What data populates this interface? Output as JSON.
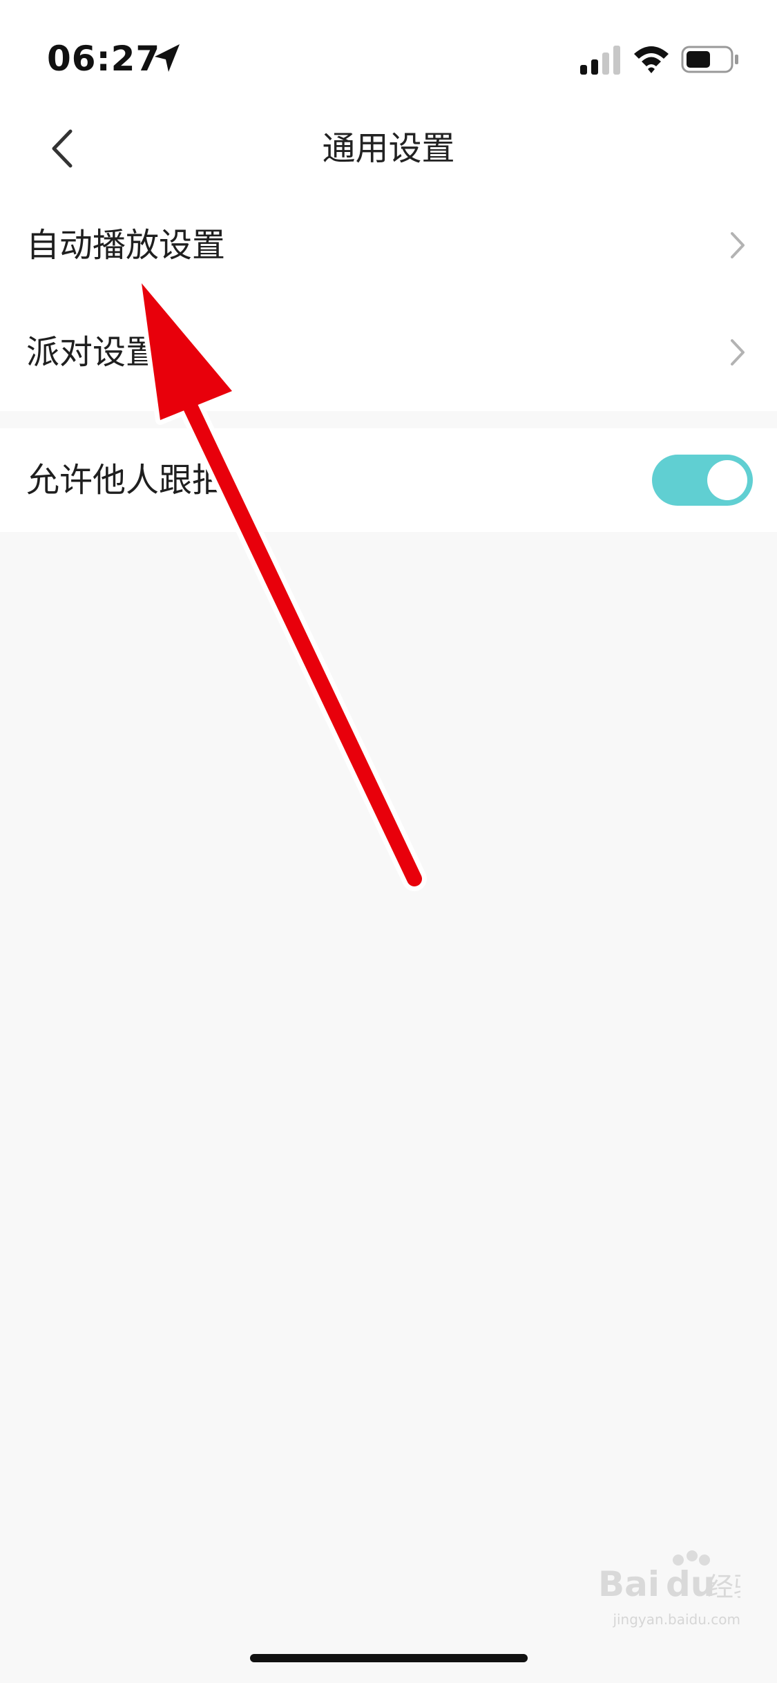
{
  "status_bar": {
    "time": "06:27",
    "icons": [
      "location-arrow-icon",
      "cellular-signal-icon",
      "wifi-icon",
      "battery-icon"
    ]
  },
  "nav": {
    "title": "通用设置",
    "back_icon": "chevron-left-icon"
  },
  "settings": {
    "items": [
      {
        "label": "自动播放设置",
        "accessory": "chevron-right-icon"
      },
      {
        "label": "派对设置",
        "accessory": "chevron-right-icon"
      },
      {
        "label": "允许他人跟拍",
        "accessory": "toggle",
        "toggle_on": true
      }
    ]
  },
  "annotation": {
    "arrow_color": "#e8000b"
  },
  "watermark": {
    "logo": "Baidu经验",
    "url": "jingyan.baidu.com"
  },
  "colors": {
    "accent": "#60cfd2",
    "background": "#f8f8f8"
  }
}
